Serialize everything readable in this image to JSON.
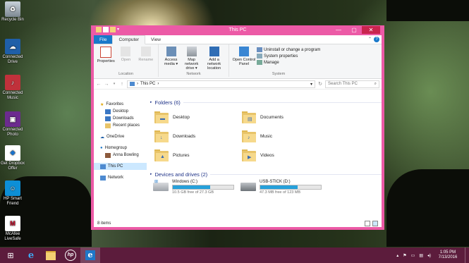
{
  "desktop": {
    "icons": [
      {
        "label": "Recycle Bin",
        "icon": "recycle-bin-icon"
      },
      {
        "label": "Connected Drive",
        "icon": "connected-drive-icon"
      },
      {
        "label": "Connected Music",
        "icon": "connected-music-icon"
      },
      {
        "label": "Connected Photo",
        "icon": "connected-photo-icon"
      },
      {
        "label": "Get Dropbox Offer",
        "icon": "dropbox-icon"
      },
      {
        "label": "HP Smart Friend",
        "icon": "hp-smart-friend-icon"
      },
      {
        "label": "McAfee LiveSafe",
        "icon": "mcafee-icon"
      }
    ]
  },
  "window": {
    "title": "This PC",
    "tabs": [
      "File",
      "Computer",
      "View"
    ],
    "ribbon": {
      "location": {
        "label": "Location",
        "buttons": [
          {
            "label": "Properties",
            "enabled": true
          },
          {
            "label": "Open",
            "enabled": false
          },
          {
            "label": "Rename",
            "enabled": false
          }
        ]
      },
      "network": {
        "label": "Network",
        "buttons": [
          {
            "label": "Access media ▾"
          },
          {
            "label": "Map network drive ▾"
          },
          {
            "label": "Add a network location"
          }
        ]
      },
      "system": {
        "label": "System",
        "open_control_panel": "Open Control Panel",
        "items": [
          "Uninstall or change a program",
          "System properties",
          "Manage"
        ]
      }
    },
    "address": {
      "path": "This PC",
      "search_placeholder": "Search This PC"
    },
    "nav": {
      "favorites_label": "Favorites",
      "favorites": [
        "Desktop",
        "Downloads",
        "Recent places"
      ],
      "onedrive": "OneDrive",
      "homegroup_label": "Homegroup",
      "homegroup_user": "Anna Bowling",
      "this_pc": "This PC",
      "network": "Network"
    },
    "folders_header": "Folders (6)",
    "folders": [
      "Desktop",
      "Documents",
      "Downloads",
      "Music",
      "Pictures",
      "Videos"
    ],
    "drives_header": "Devices and drives (2)",
    "drives": [
      {
        "name": "Windows (C:)",
        "free": "10.5 GB free of 27.3 GB",
        "used_fraction": 0.62
      },
      {
        "name": "USB-STICK (D:)",
        "free": "47.3 MB free of 123 MB",
        "used_fraction": 0.62
      }
    ],
    "status": "8 items"
  },
  "taskbar": {
    "time": "1:05 PM",
    "date": "7/13/2016"
  },
  "colors": {
    "window_frame": "#ec5aa6",
    "taskbar": "#5c1c3c",
    "accent": "#1979ca",
    "header_text": "#1e3287",
    "drive_bar": "#26a0da"
  }
}
